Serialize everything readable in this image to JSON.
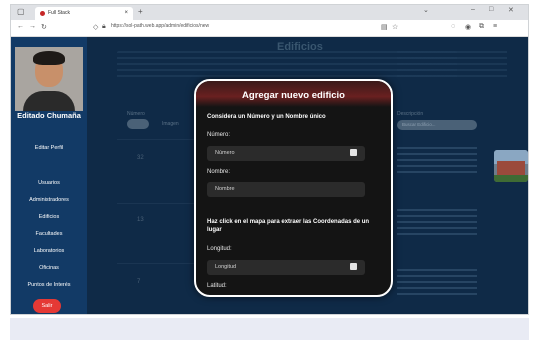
{
  "browser": {
    "tab_title": "Full Stack",
    "url": "https://sol-path.web.app/admin/edificios/new",
    "close_glyph": "×",
    "newtab_glyph": "+"
  },
  "sidebar": {
    "user_name": "Editado Chumaña",
    "edit_profile": "Editar Perfil",
    "items": [
      "Usuarios",
      "Administradores",
      "Edificios",
      "Facultades",
      "Laboratorios",
      "Oficinas",
      "Puntos de Interés"
    ],
    "logout": "Salir"
  },
  "page": {
    "title": "Edificios",
    "col_numero": "Número",
    "col_imagen": "Imagen",
    "col_descripcion": "Descripción",
    "search_placeholder": "Buscar Edificio...",
    "row_numbers": [
      "32",
      "13",
      "7"
    ]
  },
  "modal": {
    "title": "Agregar nuevo edificio",
    "subtitle": "Considera un Número y un Nombre único",
    "numero_label": "Número:",
    "numero_placeholder": "Número",
    "nombre_label": "Nombre:",
    "nombre_placeholder": "Nombre",
    "map_hint": "Haz click en el mapa para extraer las Coordenadas de un lugar",
    "longitud_label": "Longitud:",
    "longitud_placeholder": "Longitud",
    "latitud_label": "Latitud:"
  },
  "colors": {
    "sidebar": "#123a66",
    "logout": "#e53935",
    "modal_bg": "#141414",
    "modal_border": "#ffffff"
  }
}
